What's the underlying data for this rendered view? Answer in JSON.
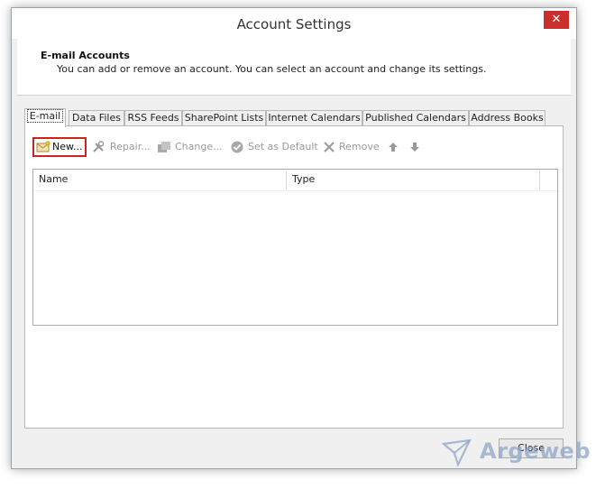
{
  "window": {
    "title": "Account Settings",
    "close_glyph": "✕"
  },
  "header": {
    "title": "E-mail Accounts",
    "description": "You can add or remove an account. You can select an account and change its settings."
  },
  "tabs": [
    {
      "label": "E-mail",
      "active": true
    },
    {
      "label": "Data Files"
    },
    {
      "label": "RSS Feeds"
    },
    {
      "label": "SharePoint Lists"
    },
    {
      "label": "Internet Calendars"
    },
    {
      "label": "Published Calendars"
    },
    {
      "label": "Address Books"
    }
  ],
  "toolbar": {
    "new_label": "New...",
    "repair_label": "Repair...",
    "change_label": "Change...",
    "set_default_label": "Set as Default",
    "remove_label": "Remove"
  },
  "list": {
    "columns": [
      "Name",
      "Type"
    ]
  },
  "footer": {
    "close_label": "Close"
  },
  "watermark": {
    "text": "Argeweb"
  },
  "colors": {
    "highlight_border": "#cc2222",
    "close_button": "#c9302c"
  }
}
